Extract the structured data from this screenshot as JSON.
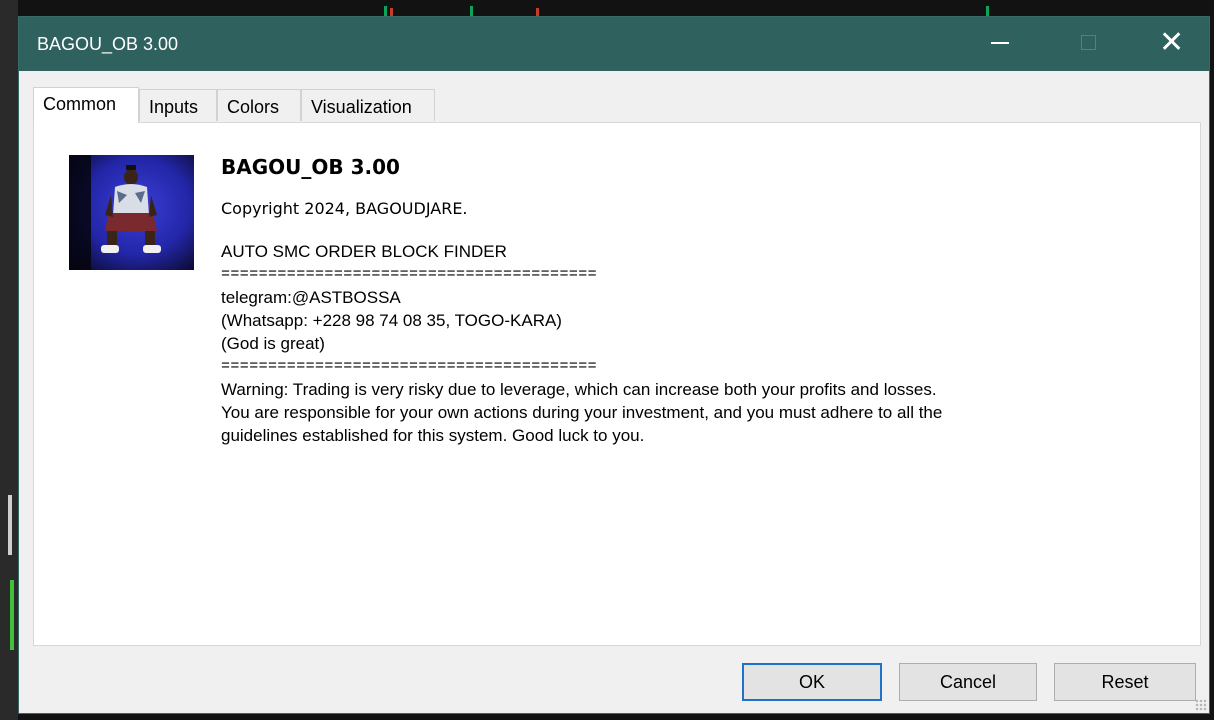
{
  "window": {
    "title": "BAGOU_OB 3.00",
    "title_bar_color": "#2f615f"
  },
  "title_controls": {
    "minimize_icon": "minimize-icon",
    "maximize_icon": "maximize-icon",
    "close_icon": "close-icon",
    "close_glyph": "✕"
  },
  "tabs": [
    {
      "label": "Common",
      "active": true
    },
    {
      "label": "Inputs",
      "active": false
    },
    {
      "label": "Colors",
      "active": false
    },
    {
      "label": "Visualization",
      "active": false
    }
  ],
  "common": {
    "name": "BAGOU_OB 3.00",
    "copyright": "Copyright 2024, BAGOUDJARE.",
    "description": [
      "AUTO SMC ORDER BLOCK FINDER",
      "========================================",
      "telegram:@ASTBOSSA",
      "(Whatsapp: +228 98 74 08 35,  TOGO-KARA)",
      "(God is great)",
      "========================================",
      "Warning: Trading is very risky due to leverage, which can increase both your profits and losses.",
      "You are responsible for your own actions during your investment, and you must adhere to all the",
      "guidelines established for this system. Good luck to you."
    ]
  },
  "buttons": {
    "ok": "OK",
    "cancel": "Cancel",
    "reset": "Reset"
  }
}
